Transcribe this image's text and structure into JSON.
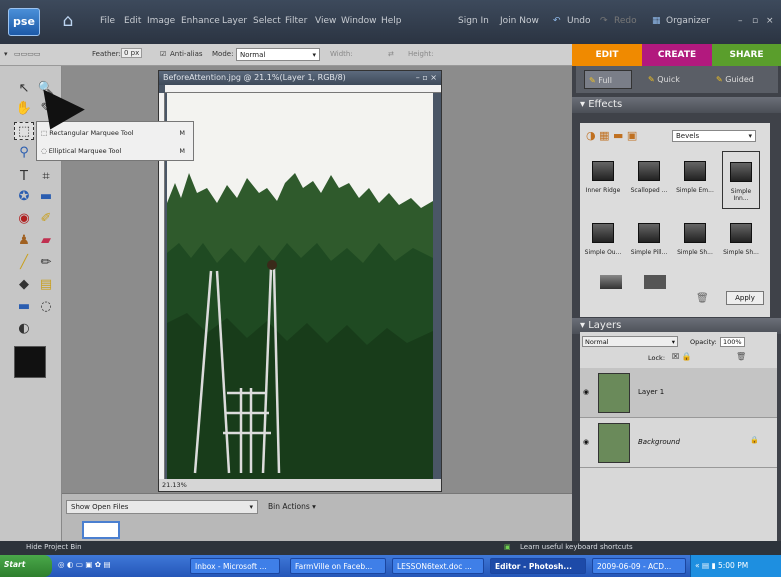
{
  "app": {
    "logo": "pse"
  },
  "menu": [
    "File",
    "Edit",
    "Image",
    "Enhance",
    "Layer",
    "Select",
    "Filter",
    "View",
    "Window",
    "Help"
  ],
  "top_right": {
    "signin": "Sign In",
    "joinnow": "Join Now",
    "undo": "Undo",
    "redo": "Redo",
    "organizer": "Organizer"
  },
  "options": {
    "feather_label": "Feather:",
    "feather_value": "0 px",
    "antialias": "Anti-alias",
    "mode_label": "Mode:",
    "mode_value": "Normal",
    "width_label": "Width:",
    "height_label": "Height:"
  },
  "tabs": {
    "edit": "EDIT",
    "create": "CREATE",
    "share": "SHARE"
  },
  "mode_tabs": {
    "full": "Full",
    "quick": "Quick",
    "guided": "Guided"
  },
  "document": {
    "title": "BeforeAttention.jpg @ 21.1%(Layer 1, RGB/8)",
    "zoom": "21.13%"
  },
  "flyout": [
    {
      "label": "Rectangular Marquee Tool",
      "key": "M"
    },
    {
      "label": "Elliptical Marquee Tool",
      "key": "M"
    }
  ],
  "effects": {
    "header": "Effects",
    "category": "Bevels",
    "items": [
      "Inner Ridge",
      "Scalloped ...",
      "Simple Em...",
      "Simple Inn...",
      "Simple Ou...",
      "Simple Pill...",
      "Simple Sh...",
      "Simple Sh..."
    ],
    "apply": "Apply"
  },
  "layers": {
    "header": "Layers",
    "blend": "Normal",
    "opacity_label": "Opacity:",
    "opacity_value": "100%",
    "lock_label": "Lock:",
    "items": [
      {
        "name": "Layer 1"
      },
      {
        "name": "Background"
      }
    ]
  },
  "project_bin": {
    "show": "Show Open Files",
    "actions": "Bin Actions ▾",
    "hide": "Hide Project Bin"
  },
  "status": {
    "tip": "Learn useful keyboard shortcuts"
  },
  "taskbar": {
    "start": "Start",
    "items": [
      "Inbox - Microsoft ...",
      "FarmVille on Faceb...",
      "LESSON6text.doc ...",
      "Editor - Photosh...",
      "2009-06-09 - ACD..."
    ],
    "time": "5:00 PM"
  },
  "colors": {
    "edit_tab": "#f08a00",
    "create_tab": "#b2197e",
    "share_tab": "#5a9e2c"
  }
}
